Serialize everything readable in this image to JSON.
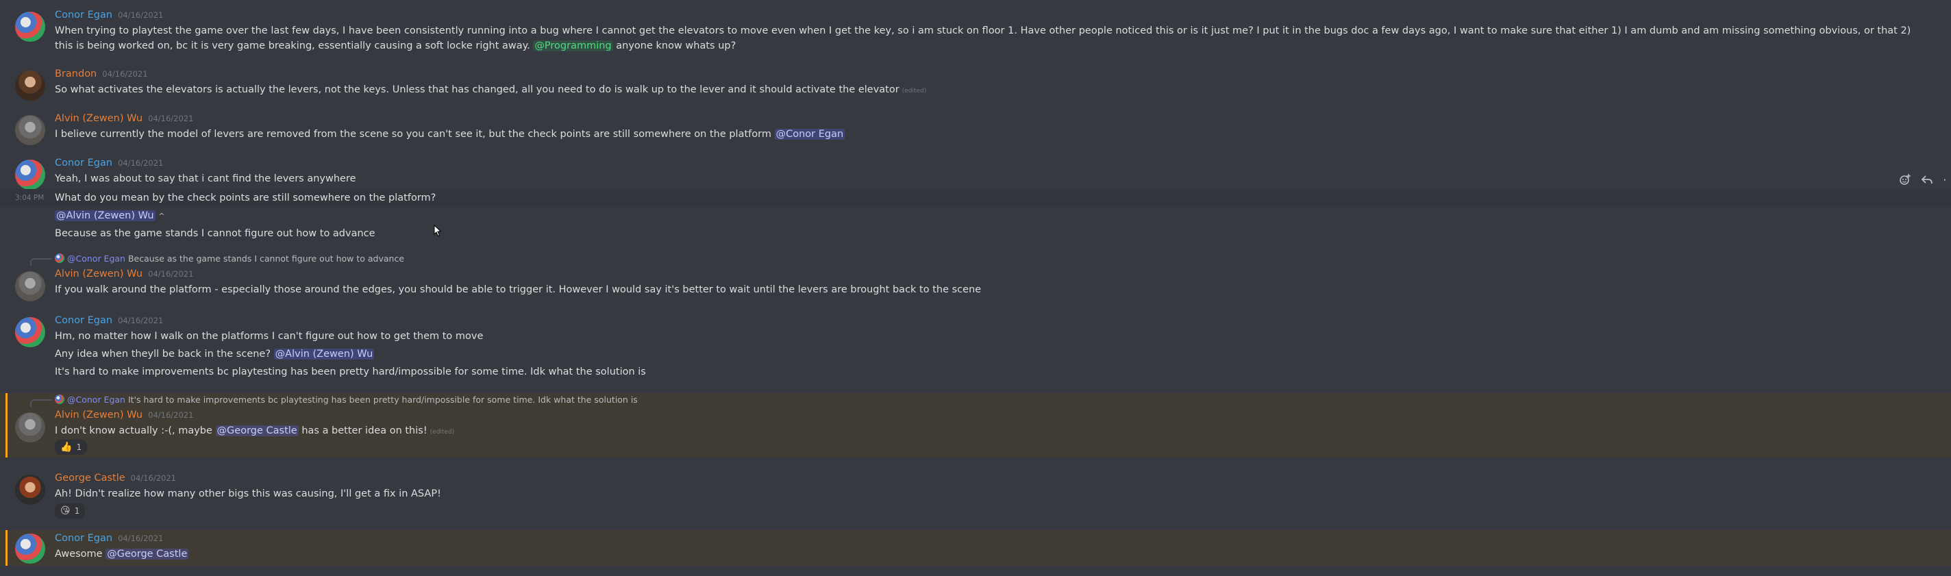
{
  "messages": {
    "m1": {
      "author": "Conor Egan",
      "timestamp": "04/16/2021",
      "text_a": "When trying to playtest the game over the last few days, I have been consistently running into a bug where I cannot get the elevators to move even when I get the key, so i am stuck on floor 1. Have other people noticed this or is it just me? I put it in the bugs doc a few days ago, I want to make sure that either 1) I am dumb and am missing something obvious, or that 2) this is being worked on, bc it is very game",
      "text_b": "breaking, essentially causing a soft locke right away.",
      "mention": "@Programming",
      "text_c": "anyone know whats up?"
    },
    "m2": {
      "author": "Brandon",
      "timestamp": "04/16/2021",
      "text": "So what activates the elevators is actually the levers, not the keys. Unless that has changed, all you need to do is walk up to the lever and it should activate the elevator",
      "edited": "(edited)"
    },
    "m3": {
      "author": "Alvin (Zewen) Wu",
      "timestamp": "04/16/2021",
      "text": "I believe currently the model of levers are removed from the scene so you can't see it, but the check points are still somewhere on the platform",
      "mention": "@Conor Egan"
    },
    "m4": {
      "author": "Conor Egan",
      "timestamp": "04/16/2021",
      "line1": "Yeah, I was about to say that i cant find the levers anywhere",
      "side_time": "3:04 PM",
      "line2": "What do you mean by the check points are still somewhere on the platform?",
      "mention": "@Alvin (Zewen) Wu",
      "mention_suffix": "^",
      "line4": "Because as the game stands I cannot figure out how to advance"
    },
    "m5": {
      "reply_mention": "@Conor Egan",
      "reply_text": "Because as the game stands I cannot figure out how to advance",
      "author": "Alvin (Zewen) Wu",
      "timestamp": "04/16/2021",
      "text": "If you walk around the platform - especially those around the edges, you should be able to trigger it. However I would say it's better to wait until the levers are brought back to the scene"
    },
    "m6": {
      "author": "Conor Egan",
      "timestamp": "04/16/2021",
      "line1": "Hm, no matter how I walk on the platforms I can't figure out how to get them to move",
      "line2": "Any idea when theyll be back in the scene?",
      "mention": "@Alvin (Zewen) Wu",
      "line3": "It's hard to make improvements bc playtesting has been pretty hard/impossible for some time. Idk what the solution is"
    },
    "m7": {
      "reply_mention": "@Conor Egan",
      "reply_text": "It's hard to make improvements bc playtesting has been pretty hard/impossible for some time. Idk what the solution is",
      "author": "Alvin (Zewen) Wu",
      "timestamp": "04/16/2021",
      "text_a": "I don't know actually :-(, maybe",
      "mention": "@George Castle",
      "text_b": "has a better idea on this!",
      "edited": "(edited)",
      "reaction_emoji": "👍",
      "reaction_count": "1"
    },
    "m8": {
      "author": "George Castle",
      "timestamp": "04/16/2021",
      "text": "Ah! Didn't realize how many other bigs this was causing, I'll get a fix in ASAP!",
      "reaction_emoji": "😘",
      "reaction_count": "1"
    },
    "m9": {
      "author": "Conor Egan",
      "timestamp": "04/16/2021",
      "text": "Awesome",
      "mention": "@George Castle"
    }
  },
  "icons": {
    "add_reaction": "add-reaction-icon",
    "reply": "reply-icon"
  },
  "colors": {
    "background": "#36393f",
    "blue_name": "#4ba3e3",
    "orange_name": "#e67e3a",
    "mention_highlight": "#faa61a"
  }
}
